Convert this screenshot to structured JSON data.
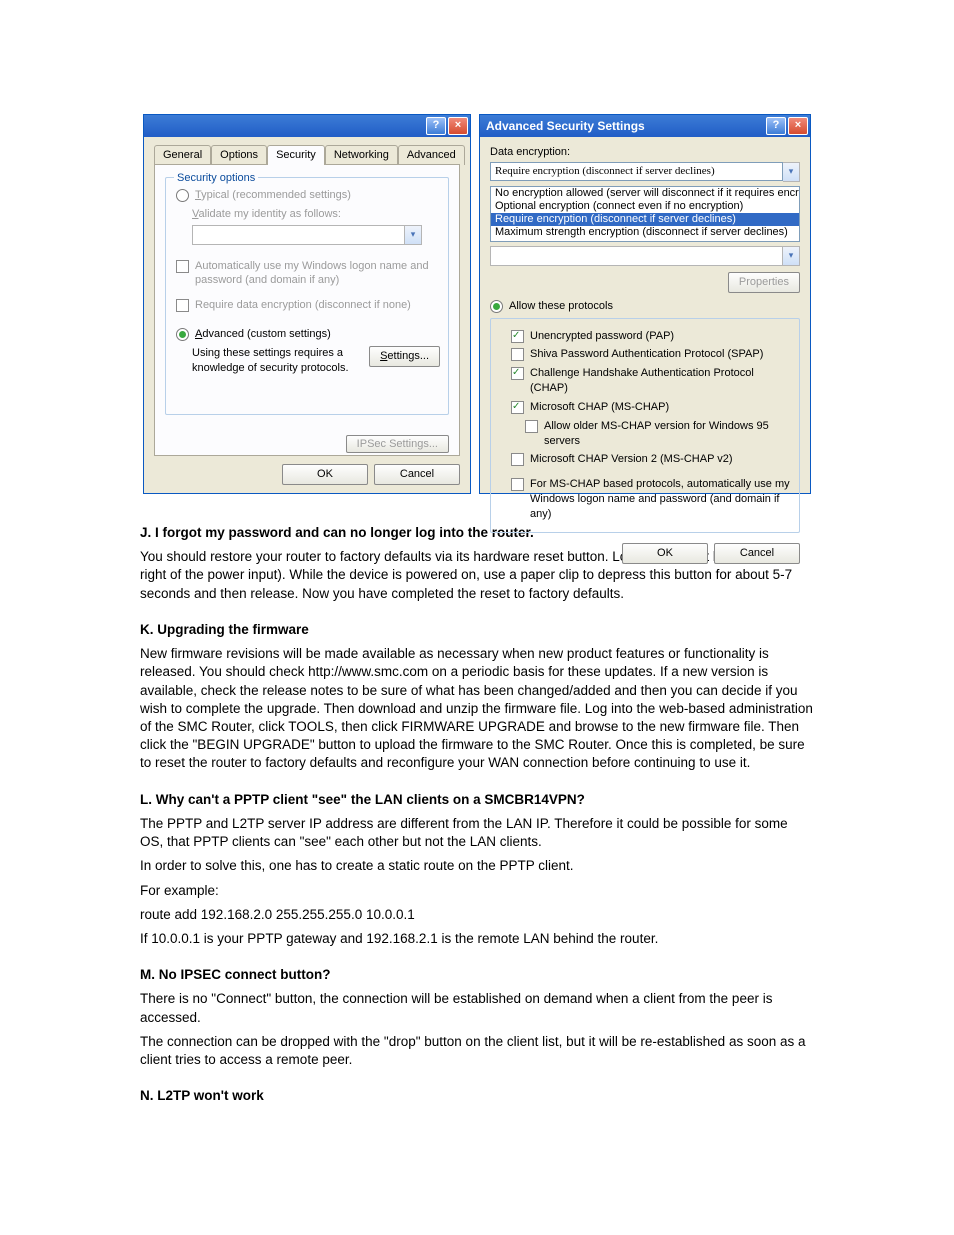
{
  "leftWindow": {
    "titlebarIconAlt": "globe",
    "tabs": [
      "General",
      "Options",
      "Security",
      "Networking",
      "Advanced"
    ],
    "activeTabIndex": 2,
    "group_title": "Security options",
    "typical_label": "Typical (recommended settings)",
    "validate_label": "Validate my identity as follows:",
    "auto_logon_label": "Automatically use my Windows logon name and password (and domain if any)",
    "require_enc_label": "Require data encryption (disconnect if none)",
    "advanced_label": "Advanced (custom settings)",
    "advanced_note": "Using these settings requires a knowledge of security protocols.",
    "settings_btn": "Settings...",
    "ipsec_btn": "IPSec Settings...",
    "ok": "OK",
    "cancel": "Cancel"
  },
  "rightWindow": {
    "title": "Advanced Security Settings",
    "data_enc_label": "Data encryption:",
    "combo_value": "Require encryption (disconnect if server declines)",
    "options": [
      "No encryption allowed (server will disconnect if it requires encryption)",
      "Optional encryption (connect even if no encryption)",
      "Require encryption (disconnect if server declines)",
      "Maximum strength encryption (disconnect if server declines)"
    ],
    "selectedOptionIndex": 2,
    "properties_btn": "Properties",
    "allow_label": "Allow these protocols",
    "protocols": [
      {
        "label": "Unencrypted password (PAP)",
        "checked": true,
        "deep": false
      },
      {
        "label": "Shiva Password Authentication Protocol (SPAP)",
        "checked": false,
        "deep": false
      },
      {
        "label": "Challenge Handshake Authentication Protocol (CHAP)",
        "checked": true,
        "deep": false
      },
      {
        "label": "Microsoft CHAP (MS-CHAP)",
        "checked": true,
        "deep": false
      },
      {
        "label": "Allow older MS-CHAP version for Windows 95 servers",
        "checked": false,
        "deep": true
      },
      {
        "label": "Microsoft CHAP Version 2 (MS-CHAP v2)",
        "checked": false,
        "deep": false
      }
    ],
    "mschap_auto_label": "For MS-CHAP based protocols, automatically use my Windows logon name and password (and domain if any)",
    "ok": "OK",
    "cancel": "Cancel"
  },
  "doc": {
    "j_title": "J. I forgot my password and can no longer log into the router.",
    "j_body": "You should restore your router to factory defaults via its hardware reset button. Locate the reset button (to the right of the power input). While the device is powered on, use a paper clip to depress this button for about 5-7 seconds and then release. Now you have completed the reset to factory defaults.",
    "k_title": "K. Upgrading the firmware",
    "k_body": "New firmware revisions will be made available as necessary when new product features or functionality is released. You should check http://www.smc.com on a periodic basis for these updates. If a new version is available, check the release notes to be sure of what has been changed/added and then you can decide if you wish to complete the upgrade. Then download and unzip the firmware file. Log into the web-based administration of the SMC Router, click TOOLS, then click FIRMWARE UPGRADE and browse to the new firmware file. Then click the \"BEGIN UPGRADE\" button to upload the firmware to the SMC Router. Once this is completed, be sure to reset the router to factory defaults and reconfigure your WAN connection before continuing to use it.",
    "l_title": "L. Why can't a PPTP client \"see\" the LAN clients on a SMCBR14VPN?",
    "l_b1": "The PPTP and L2TP server IP address are different from the LAN IP. Therefore it could be possible for some OS, that PPTP clients can \"see\" each other but not the LAN clients.",
    "l_b2": "In order to solve this, one has to create a static route on the PPTP client.",
    "l_b3": "For example:",
    "l_b4": "route add 192.168.2.0 255.255.255.0 10.0.0.1",
    "l_b5": "If 10.0.0.1 is your PPTP gateway and 192.168.2.1 is the remote LAN behind the router.",
    "m_title": "M. No IPSEC connect button?",
    "m_b1": "There is no \"Connect\" button, the connection will be established on demand when a client from the peer is accessed.",
    "m_b2": "The connection can be dropped with the \"drop\" button on the client list, but it will be re-established as soon as a client tries to access a remote peer.",
    "n_title": "N. L2TP won't work"
  }
}
